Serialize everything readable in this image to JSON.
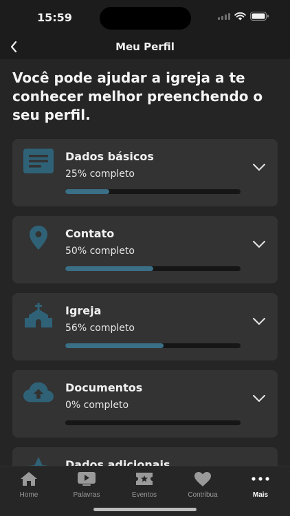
{
  "status_bar": {
    "time": "15:59"
  },
  "nav": {
    "title": "Meu Perfil",
    "back_icon": "chevron-left-icon"
  },
  "intro_text": "Você pode ajudar a igreja a te conhecer melhor preenchendo o seu perfil.",
  "colors": {
    "accent": "#3a6f86",
    "icon": "#2f6277",
    "card_bg": "#333333",
    "page_bg": "#252525"
  },
  "sections": [
    {
      "title": "Dados básicos",
      "status": "25% completo",
      "progress": 0.25,
      "icon": "document-icon"
    },
    {
      "title": "Contato",
      "status": "50% completo",
      "progress": 0.5,
      "icon": "location-pin-icon"
    },
    {
      "title": "Igreja",
      "status": "56% completo",
      "progress": 0.56,
      "icon": "church-icon"
    },
    {
      "title": "Documentos",
      "status": "0% completo",
      "progress": 0.0,
      "icon": "cloud-upload-icon"
    },
    {
      "title": "Dados adicionais",
      "icon": "star-icon"
    }
  ],
  "tabs": [
    {
      "label": "Home",
      "icon": "home-icon"
    },
    {
      "label": "Palavras",
      "icon": "video-play-icon"
    },
    {
      "label": "Eventos",
      "icon": "ticket-icon"
    },
    {
      "label": "Contribua",
      "icon": "heart-icon"
    },
    {
      "label": "Mais",
      "icon": "more-dots-icon",
      "active": true
    }
  ]
}
